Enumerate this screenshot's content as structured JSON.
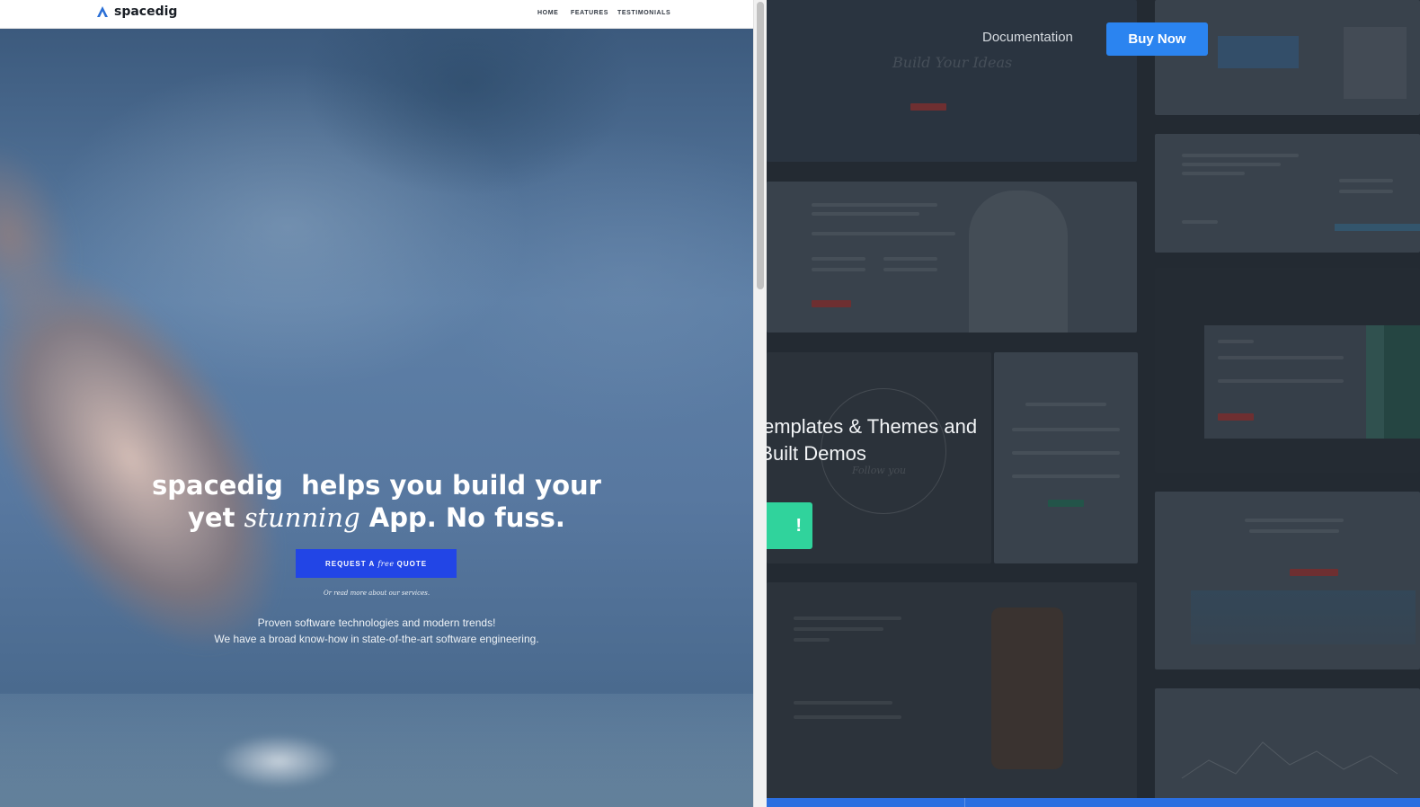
{
  "preview": {
    "logo_text": "spacedig",
    "nav": [
      "HOME",
      "FEATURES",
      "TESTIMONIALS"
    ],
    "hero": {
      "title_line1": "spacedig  helps you build your",
      "title_line2_prefix": "yet",
      "title_line2_em": "stunning",
      "title_line2_suffix": "App. No fuss.",
      "button_prefix": "REQUEST A",
      "button_em": "free",
      "button_suffix": "QUOTE",
      "read_more": "Or read more about our services.",
      "sub_line1": "Proven software technologies and modern trends!",
      "sub_line2": "We have a broad know-how in state-of-the-art software engineering."
    }
  },
  "site": {
    "nav_docs": "Documentation",
    "nav_buy": "Buy Now",
    "headline_line1": "Templates & Themes and",
    "headline_line2": "-Built Demos",
    "cta": "!",
    "thumb_text_1": "Build Your Ideas",
    "thumb_text_2": "Follow you"
  },
  "colors": {
    "accent_blue": "#2245e6",
    "buy_blue": "#2b84f0",
    "cta_green": "#30d39c"
  }
}
